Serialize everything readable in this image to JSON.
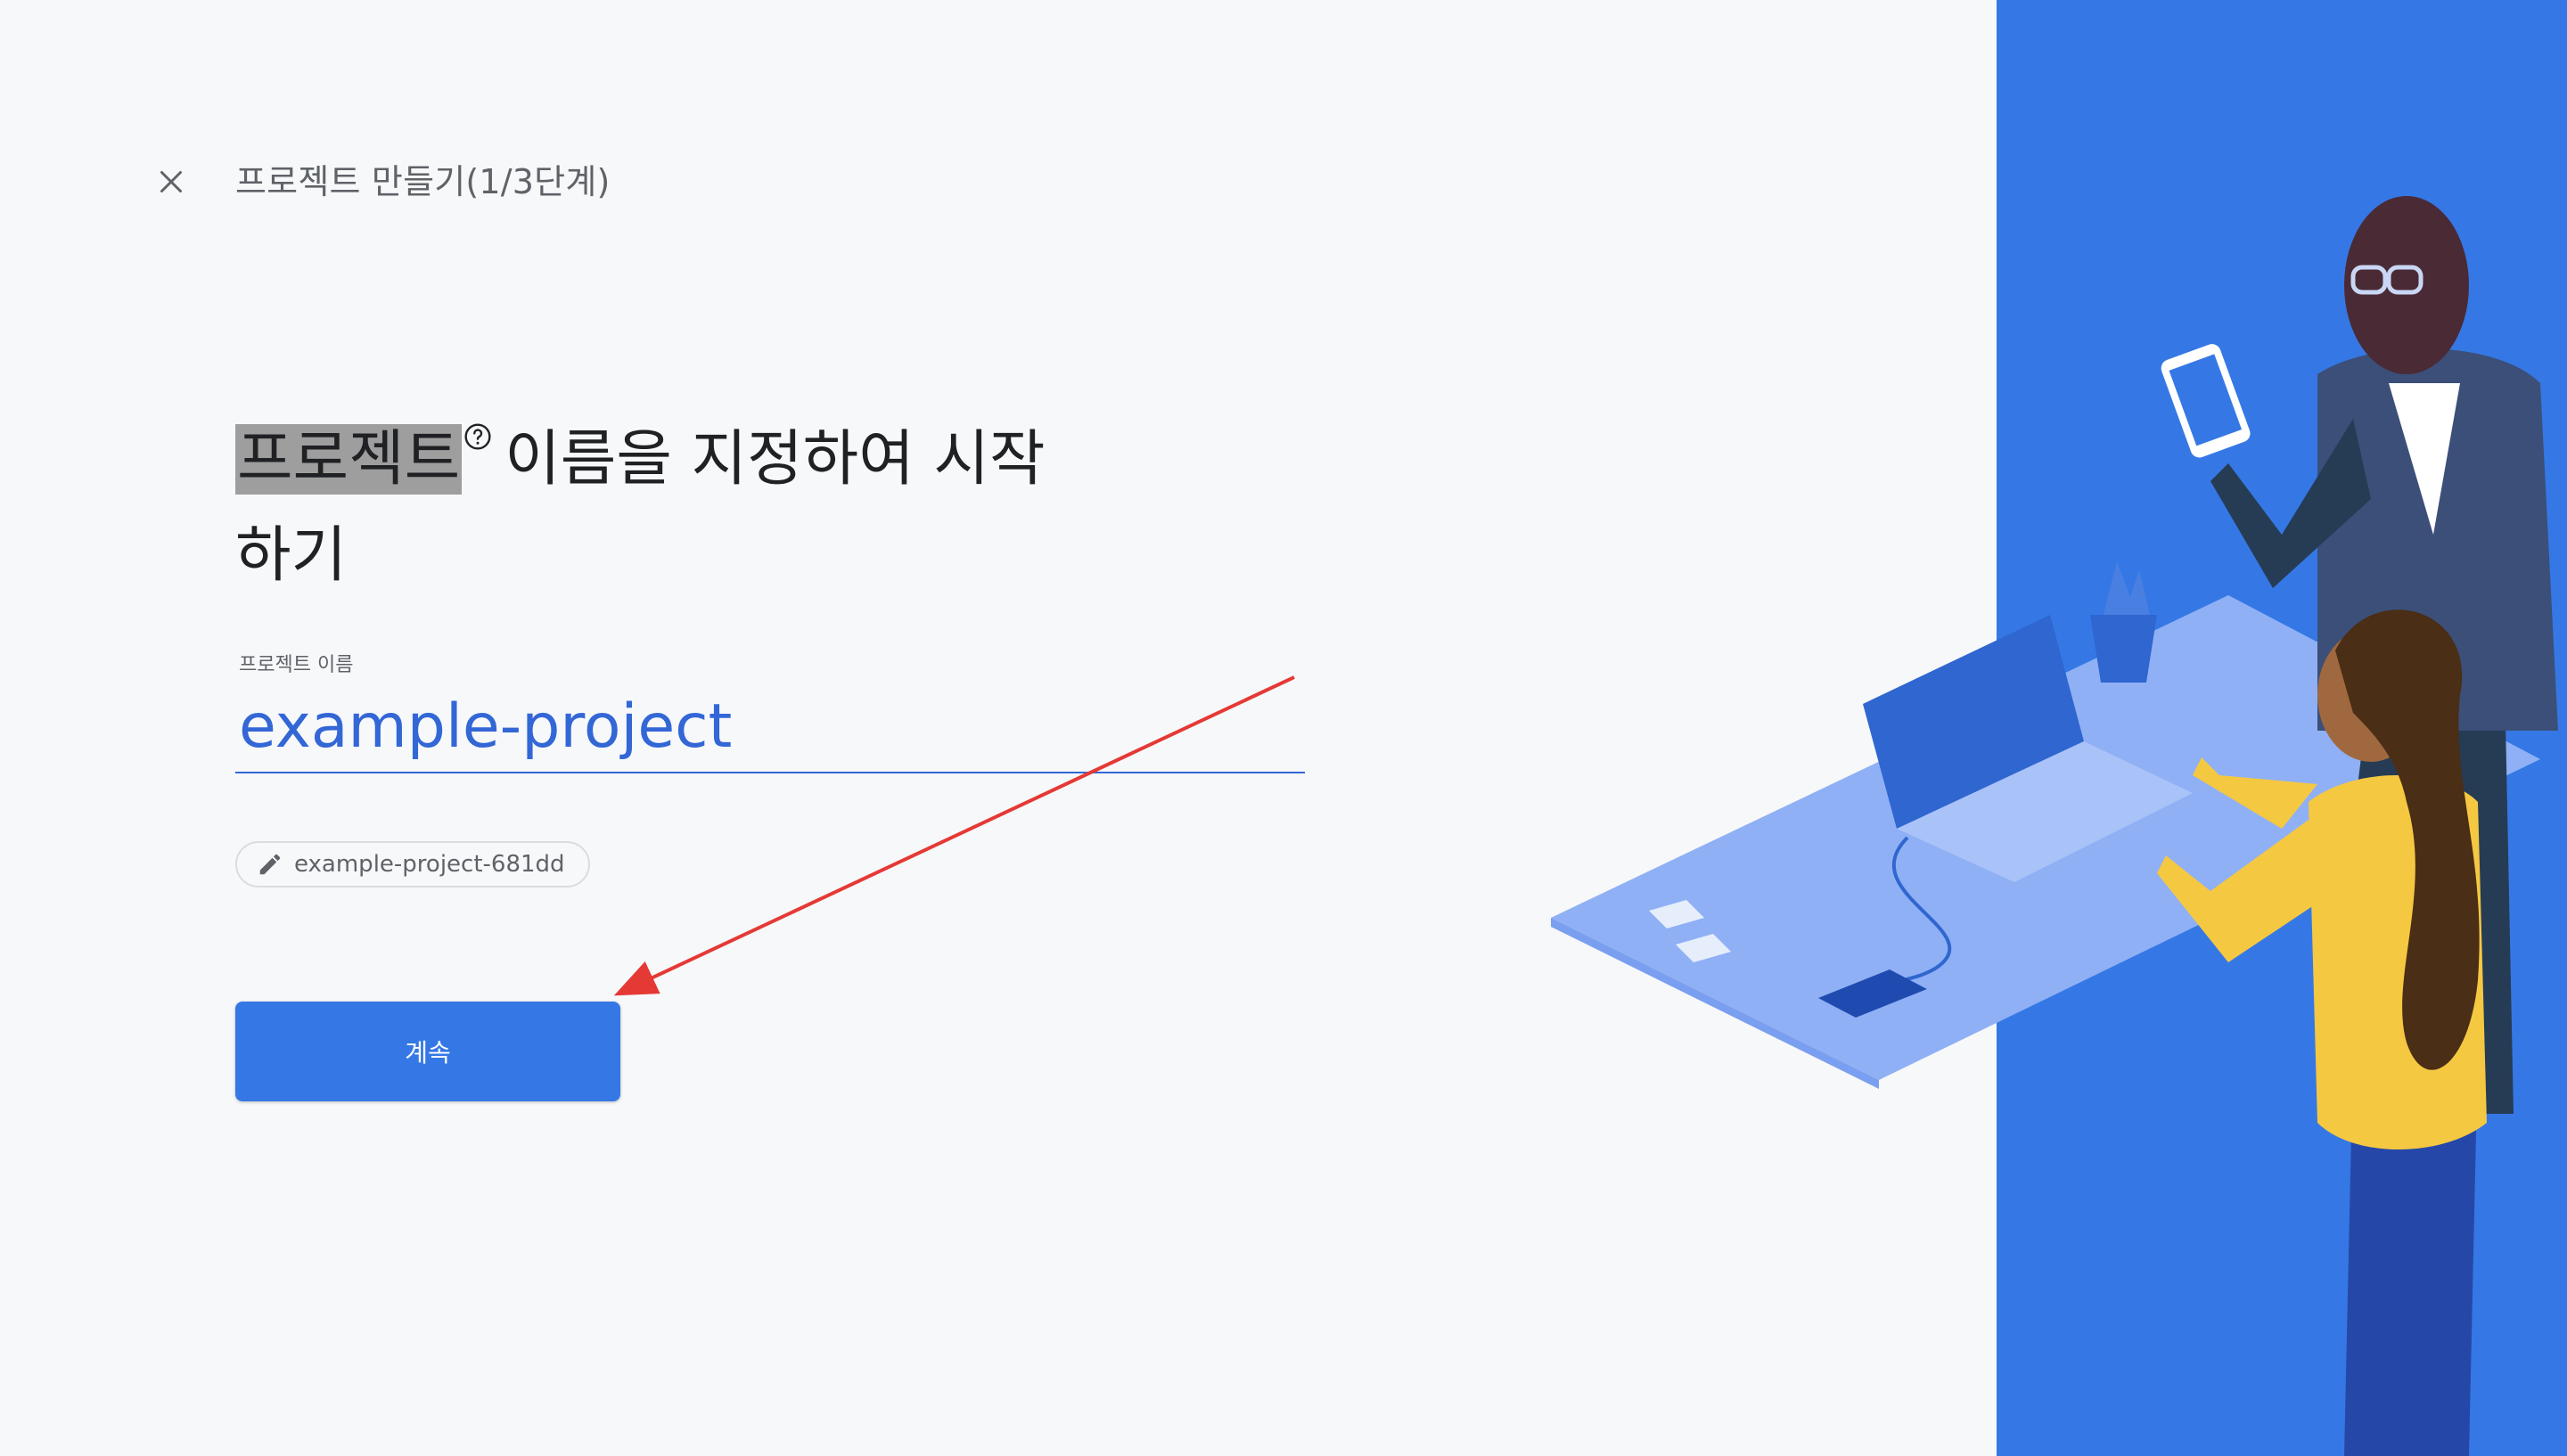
{
  "header": {
    "close_icon": "close-icon",
    "step_title": "프로젝트 만들기(1/3단계)"
  },
  "heading": {
    "highlighted_word": "프로젝트",
    "help_icon": "help-circle-icon",
    "rest_line1": "이름을 지정하여 시작",
    "rest_line2": "하기"
  },
  "project_name": {
    "label": "프로젝트 이름",
    "value": "example-project"
  },
  "project_id_chip": {
    "icon": "pencil-icon",
    "text": "example-project-681dd"
  },
  "continue_button": {
    "label": "계속"
  },
  "colors": {
    "accent": "#3578e5",
    "input_text": "#3367d6",
    "annotation_arrow": "#e53935",
    "highlight": "#9e9e9e"
  }
}
